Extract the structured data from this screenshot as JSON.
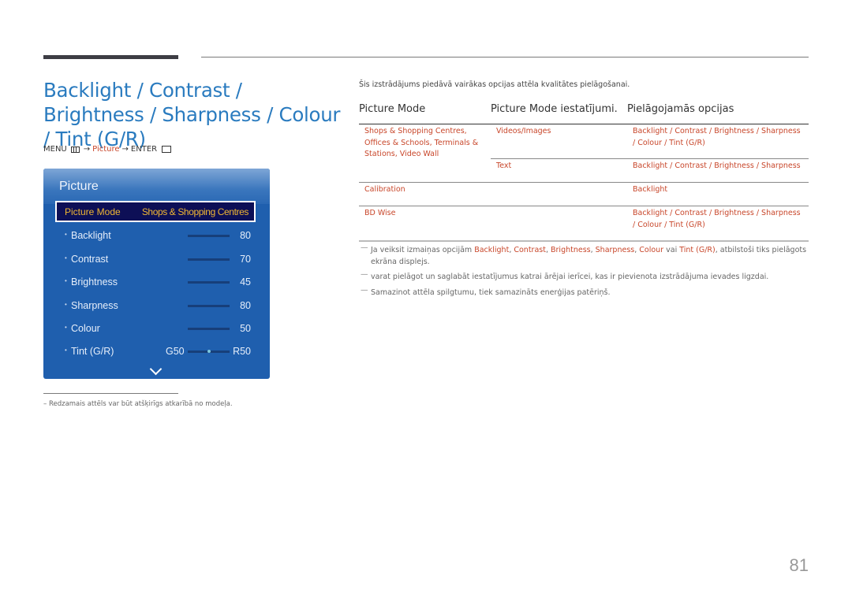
{
  "title": "Backlight / Contrast / Brightness / Sharpness / Colour / Tint (G/R)",
  "menu_path": {
    "menu": "MENU",
    "arrow": "→",
    "picture": "Picture",
    "enter": "ENTER"
  },
  "panel": {
    "title": "Picture",
    "picture_mode": {
      "label": "Picture Mode",
      "value": "Shops & Shopping Centres"
    },
    "items": [
      {
        "label": "Backlight",
        "value": "80",
        "fill": 0.8
      },
      {
        "label": "Contrast",
        "value": "70",
        "fill": 0.7
      },
      {
        "label": "Brightness",
        "value": "45",
        "fill": 0.45
      },
      {
        "label": "Sharpness",
        "value": "80",
        "fill": 0.8
      },
      {
        "label": "Colour",
        "value": "50",
        "fill": 0.5
      }
    ],
    "tint": {
      "label": "Tint (G/R)",
      "left": "G50",
      "right": "R50",
      "position": 0.5
    }
  },
  "footnote": "– Redzamais attēls var būt atšķirīgs atkarībā no modeļa.",
  "intro": "Šis izstrādājums piedāvā vairākas opcijas attēla kvalitātes pielāgošanai.",
  "table": {
    "headers": [
      "Picture Mode",
      "Picture Mode iestatījumi.",
      "Pielāgojamās opcijas"
    ],
    "rows": {
      "r1_mode_l1": "Shops & Shopping Centres,",
      "r1_mode_l2": "Offices & Schools, Terminals &",
      "r1_mode_l3": "Stations, Video Wall",
      "r1a_setting": "Videos/Images",
      "r1a_opts_l1": "Backlight / Contrast / Brightness / Sharpness",
      "r1a_opts_l2": "/ Colour / Tint (G/R)",
      "r1b_setting": "Text",
      "r1b_opts": "Backlight / Contrast / Brightness / Sharpness",
      "r2_mode": "Calibration",
      "r2_opts": "Backlight",
      "r3_mode": "BD Wise",
      "r3_opts_l1": "Backlight / Contrast / Brightness / Sharpness",
      "r3_opts_l2": "/ Colour / Tint (G/R)"
    }
  },
  "notes": {
    "n1_pre": "Ja veiksit izmaiņas opcijām ",
    "n1_backlight": "Backlight",
    "n1_contrast": "Contrast",
    "n1_brightness": "Brightness",
    "n1_sharpness": "Sharpness",
    "n1_colour": "Colour",
    "n1_vai": " vai ",
    "n1_tint": "Tint (G/R)",
    "n1_post": ", atbilstoši tiks pielāgots ekrāna displejs.",
    "n2": "varat pielāgot un saglabāt iestatījumus katrai ārējai ierīcei, kas ir pievienota izstrādājuma ievades ligzdai.",
    "n3": "Samazinot attēla spilgtumu, tiek samazināts enerģijas patēriņš."
  },
  "page_number": "81"
}
